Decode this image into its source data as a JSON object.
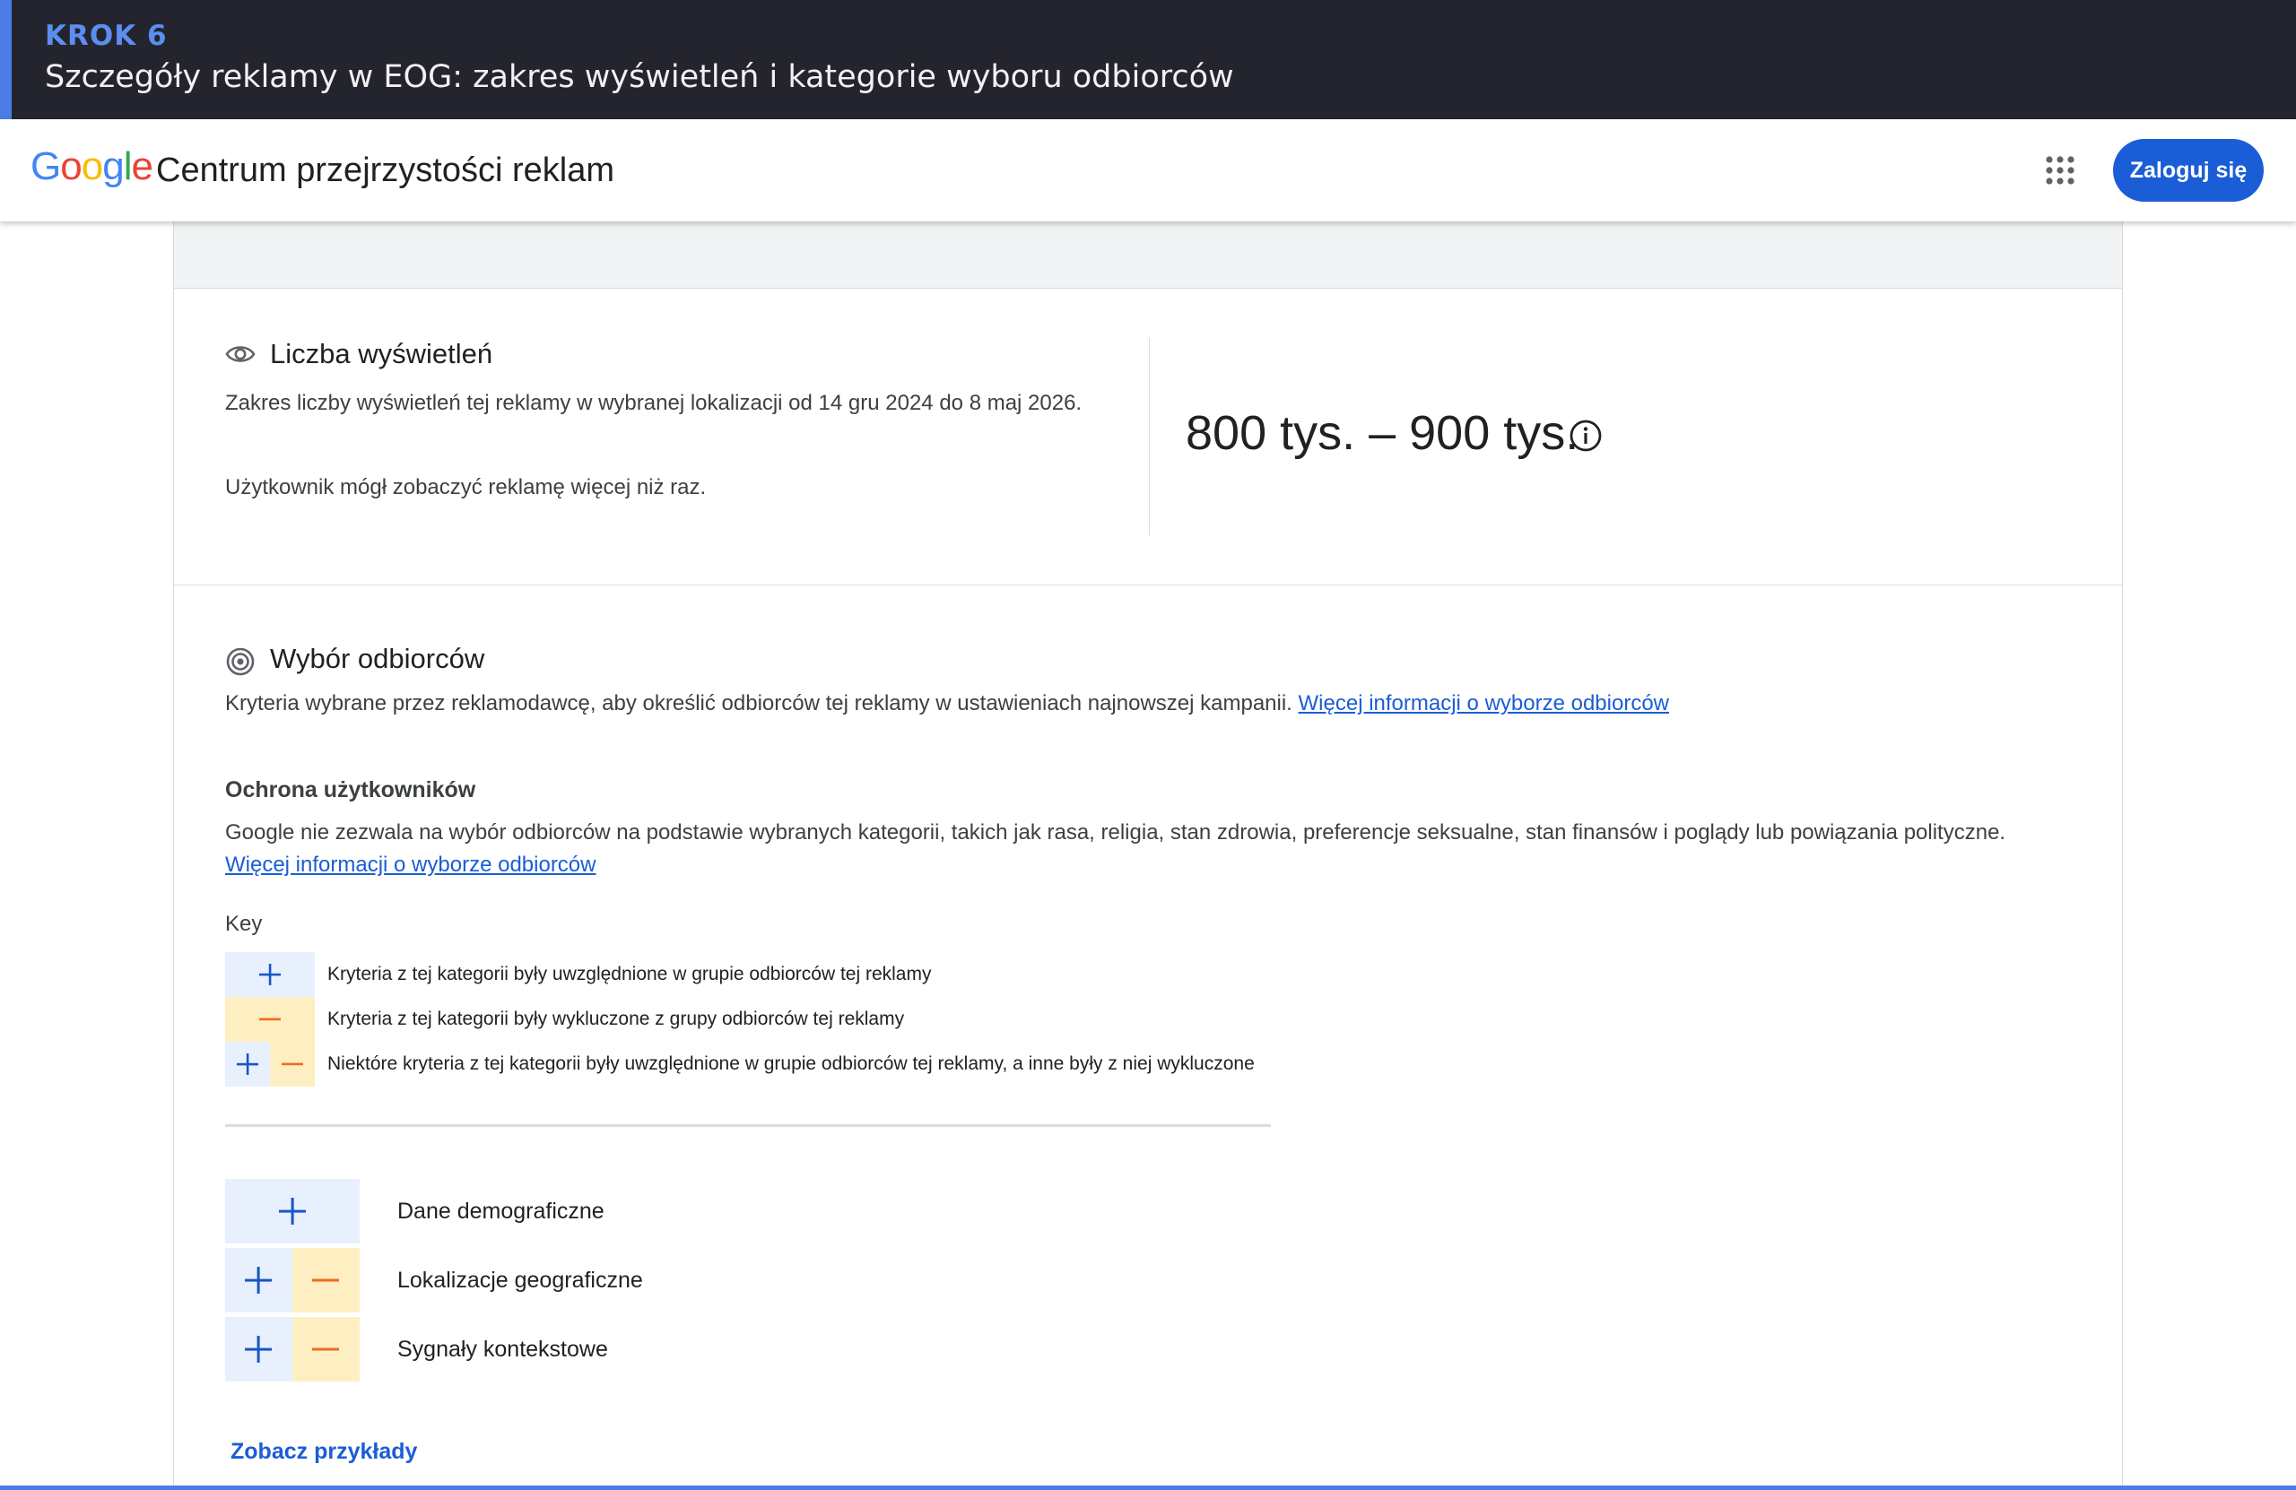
{
  "banner": {
    "step": "KROK 6",
    "title": "Szczegóły reklamy w EOG: zakres wyświetleń i kategorie wyboru odbiorców"
  },
  "header": {
    "logo_letters": [
      "G",
      "o",
      "o",
      "g",
      "l",
      "e"
    ],
    "title": "Centrum przejrzystości reklam",
    "apps_icon": "apps-grid-icon",
    "signin_label": "Zaloguj się"
  },
  "impressions": {
    "icon": "eye-icon",
    "heading": "Liczba wyświetleń",
    "description": "Zakres liczby wyświetleń tej reklamy w wybranej lokalizacji od 14 gru 2024 do 8 maj 2026.",
    "note": "Użytkownik mógł zobaczyć reklamę więcej niż raz.",
    "value": "800 tys. – 900 tys.",
    "info_icon": "info-icon"
  },
  "audience": {
    "icon": "target-icon",
    "heading": "Wybór odbiorców",
    "description": "Kryteria wybrane przez reklamodawcę, aby określić odbiorców tej reklamy w ustawieniach najnowszej kampanii.",
    "link": "Więcej informacji o wyborze odbiorców",
    "protection_title": "Ochrona użytkowników",
    "protection_text": "Google nie zezwala na wybór odbiorców na podstawie wybranych kategorii, takich jak rasa, religia, stan zdrowia, preferencje seksualne, stan finansów i poglądy lub powiązania polityczne.",
    "protection_link": "Więcej informacji o wyborze odbiorców",
    "key_label": "Key",
    "key_items": [
      "Kryteria z tej kategorii były uwzględnione w grupie odbiorców tej reklamy",
      "Kryteria z tej kategorii były wykluczone z grupy odbiorców tej reklamy",
      "Niektóre kryteria z tej kategorii były uwzględnione w grupie odbiorców tej reklamy, a inne były z niej wykluczone"
    ],
    "categories": [
      {
        "label": "Dane demograficzne",
        "status": "included"
      },
      {
        "label": "Lokalizacje geograficzne",
        "status": "included-and-excluded"
      },
      {
        "label": "Sygnały kontekstowe",
        "status": "included-and-excluded"
      }
    ],
    "examples_link": "Zobacz przykłady"
  },
  "colors": {
    "banner_bg": "#23242d",
    "accent": "#4c7de6",
    "link": "#1a5dd6",
    "included_bg": "#e8f0fe",
    "included_symbol": "#1a56c4",
    "excluded_bg": "#feefc3",
    "excluded_symbol": "#f06b1f"
  }
}
